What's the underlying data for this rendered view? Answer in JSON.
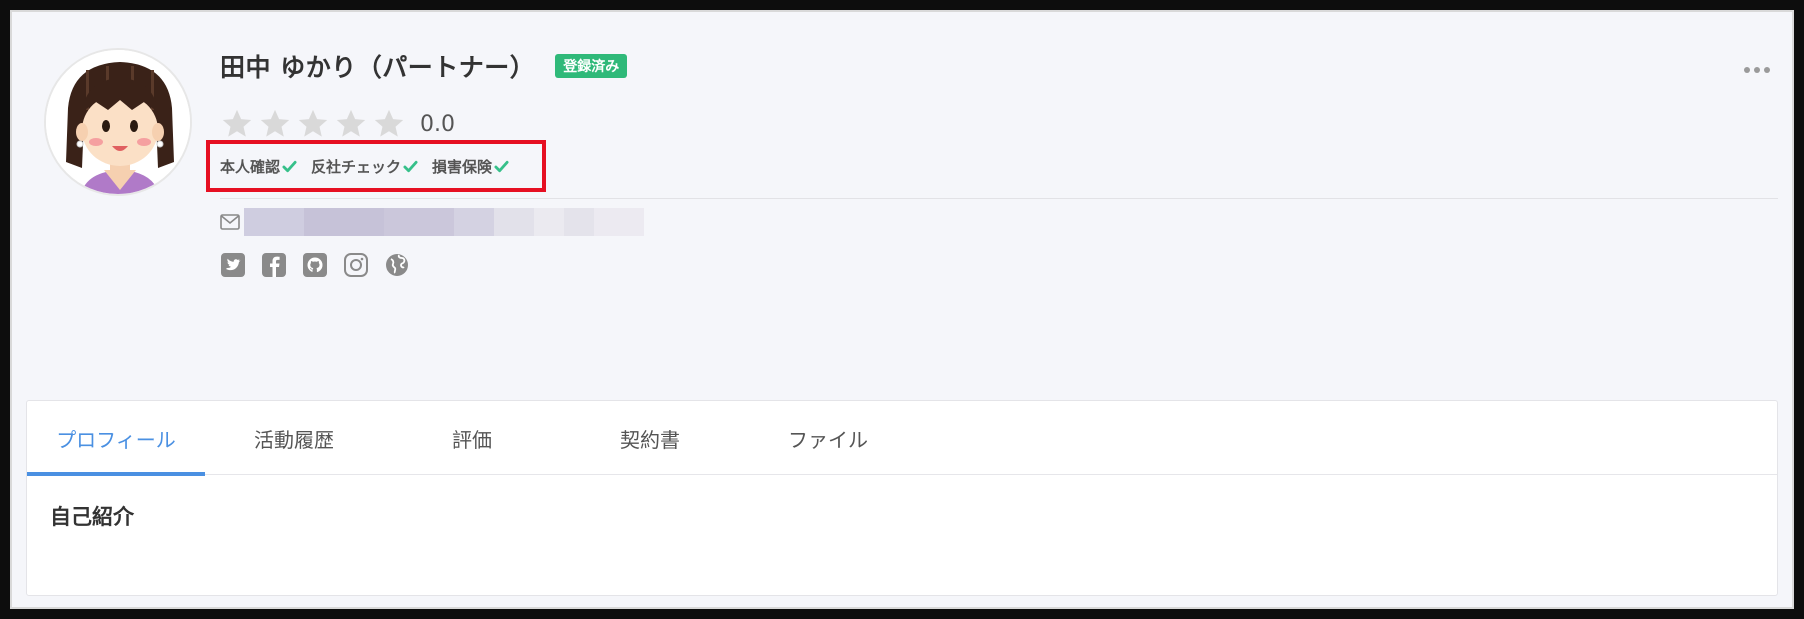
{
  "profile": {
    "name": "田中 ゆかり（パートナー）",
    "status_badge": "登録済み",
    "rating": {
      "stars_filled": 0,
      "stars_total": 5,
      "value_text": "0.0"
    },
    "verifications": [
      {
        "label": "本人確認",
        "verified": true
      },
      {
        "label": "反社チェック",
        "verified": true
      },
      {
        "label": "損害保険",
        "verified": true
      }
    ],
    "social_icons": [
      "twitter-icon",
      "facebook-icon",
      "github-icon",
      "instagram-icon",
      "globe-icon"
    ]
  },
  "tabs": [
    {
      "label": "プロフィール",
      "active": true
    },
    {
      "label": "活動履歴",
      "active": false
    },
    {
      "label": "評価",
      "active": false
    },
    {
      "label": "契約書",
      "active": false
    },
    {
      "label": "ファイル",
      "active": false
    }
  ],
  "content": {
    "section_title": "自己紹介"
  },
  "colors": {
    "accent": "#4a90e2",
    "badge": "#2fb979",
    "check": "#36c08a",
    "highlight_box": "#e60f22",
    "star_empty": "#d9d9d9",
    "icon_gray": "#9a9a9a"
  }
}
